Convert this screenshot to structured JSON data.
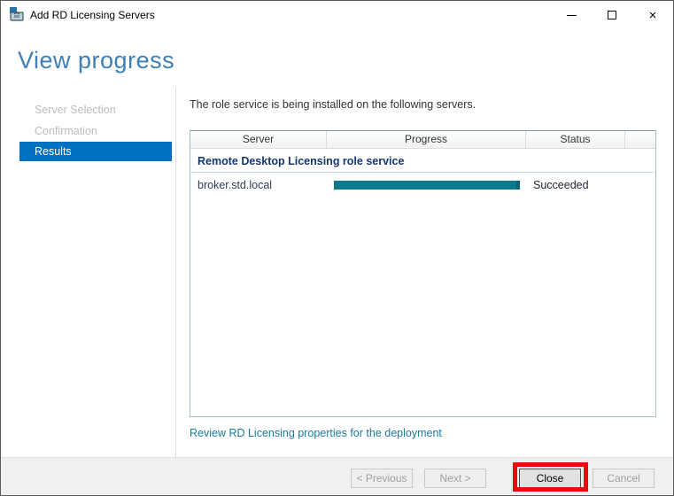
{
  "window": {
    "title": "Add RD Licensing Servers"
  },
  "icons": {
    "minimize_glyph": "–",
    "close_glyph": "×"
  },
  "header": {
    "title": "View progress"
  },
  "sidebar": {
    "items": [
      {
        "label": "Server Selection",
        "state": "disabled"
      },
      {
        "label": "Confirmation",
        "state": "disabled"
      },
      {
        "label": "Results",
        "state": "selected"
      }
    ]
  },
  "main": {
    "description": "The role service is being installed on the following servers.",
    "table": {
      "columns": [
        "Server",
        "Progress",
        "Status"
      ],
      "group_header": "Remote Desktop Licensing role service",
      "rows": [
        {
          "server": "broker.std.local",
          "progress_percent": 100,
          "status": "Succeeded"
        }
      ]
    },
    "link": "Review RD Licensing properties for the deployment"
  },
  "footer": {
    "buttons": [
      {
        "label": "< Previous",
        "enabled": false
      },
      {
        "label": "Next >",
        "enabled": false
      },
      {
        "label": "Close",
        "enabled": true,
        "highlighted": true
      },
      {
        "label": "Cancel",
        "enabled": false
      }
    ]
  },
  "colors": {
    "accent_blue": "#0070C0",
    "heading_blue": "#3E7FB6",
    "progress_teal": "#0E7B8D",
    "group_header_navy": "#16366F",
    "link_teal": "#1B7A9B",
    "annotation_red": "#E30E0E"
  }
}
